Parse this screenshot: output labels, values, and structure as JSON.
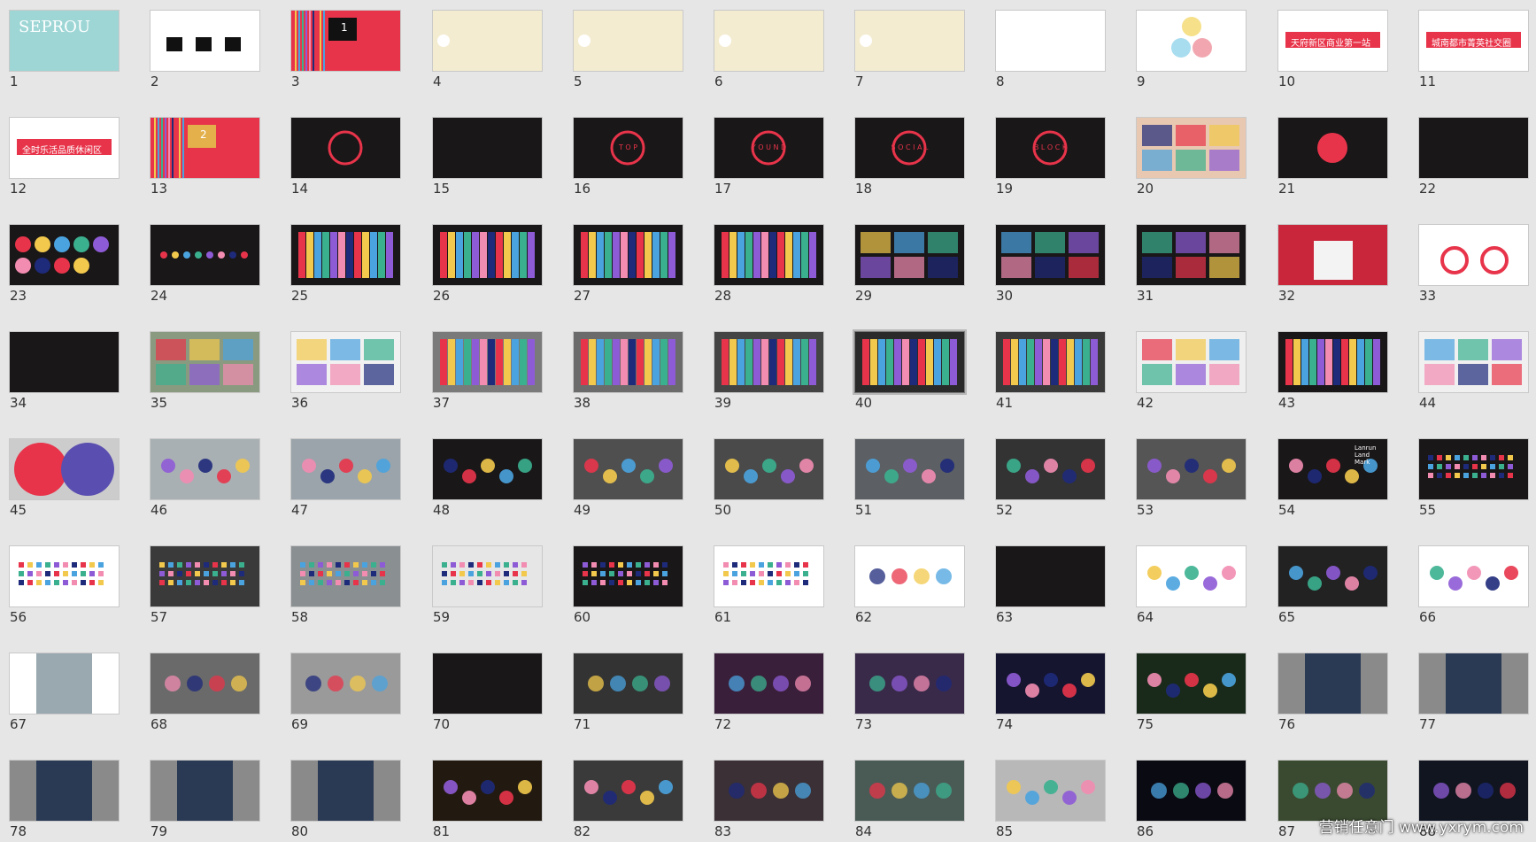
{
  "slides": [
    {
      "n": 1,
      "bg": "#9ed6d6",
      "title": "SEPROU"
    },
    {
      "n": 2,
      "bg": "#ffffff"
    },
    {
      "n": 3,
      "bg": "#e8344a",
      "title": "1"
    },
    {
      "n": 4,
      "bg": "#ffffff"
    },
    {
      "n": 5,
      "bg": "#ffffff"
    },
    {
      "n": 6,
      "bg": "#ffffff"
    },
    {
      "n": 7,
      "bg": "#ffffff"
    },
    {
      "n": 8,
      "bg": "#ffffff"
    },
    {
      "n": 9,
      "bg": "#ffffff"
    },
    {
      "n": 10,
      "bg": "#ffffff",
      "title": "天府新区商业第一站"
    },
    {
      "n": 11,
      "bg": "#ffffff",
      "title": "城南都市菁英社交圈"
    },
    {
      "n": 12,
      "bg": "#ffffff",
      "title": "全时乐活品质休闲区"
    },
    {
      "n": 13,
      "bg": "#e8344a",
      "title": "2"
    },
    {
      "n": 14,
      "bg": "#1a1718"
    },
    {
      "n": 15,
      "bg": "#1a1718"
    },
    {
      "n": 16,
      "bg": "#1a1718",
      "title": "T O P"
    },
    {
      "n": 17,
      "bg": "#1a1718",
      "title": "Y O U N D"
    },
    {
      "n": 18,
      "bg": "#1a1718",
      "title": "S O C I A L"
    },
    {
      "n": 19,
      "bg": "#1a1718",
      "title": "B L O C K"
    },
    {
      "n": 20,
      "bg": "#e8c8b0"
    },
    {
      "n": 21,
      "bg": "#1a1718"
    },
    {
      "n": 22,
      "bg": "#1a1718"
    },
    {
      "n": 23,
      "bg": "#1a1718"
    },
    {
      "n": 24,
      "bg": "#1a1718"
    },
    {
      "n": 25,
      "bg": "#1a1718"
    },
    {
      "n": 26,
      "bg": "#1a1718"
    },
    {
      "n": 27,
      "bg": "#1a1718"
    },
    {
      "n": 28,
      "bg": "#1a1718"
    },
    {
      "n": 29,
      "bg": "#1a1718"
    },
    {
      "n": 30,
      "bg": "#1a1718"
    },
    {
      "n": 31,
      "bg": "#1a1718"
    },
    {
      "n": 32,
      "bg": "#c9263c"
    },
    {
      "n": 33,
      "bg": "#ffffff"
    },
    {
      "n": 34,
      "bg": "#1a1718"
    },
    {
      "n": 35,
      "bg": "#8a9a80"
    },
    {
      "n": 36,
      "bg": "#f1f1f1"
    },
    {
      "n": 37,
      "bg": "#7a7a7a"
    },
    {
      "n": 38,
      "bg": "#6b6b6b"
    },
    {
      "n": 39,
      "bg": "#444444"
    },
    {
      "n": 40,
      "bg": "#2a2a2a"
    },
    {
      "n": 41,
      "bg": "#3a3a3a"
    },
    {
      "n": 42,
      "bg": "#efefef"
    },
    {
      "n": 43,
      "bg": "#1a1718"
    },
    {
      "n": 44,
      "bg": "#f0f0f0"
    },
    {
      "n": 45,
      "bg": "#cccccc"
    },
    {
      "n": 46,
      "bg": "#a9b0b3"
    },
    {
      "n": 47,
      "bg": "#9aa4aa"
    },
    {
      "n": 48,
      "bg": "#1a1718"
    },
    {
      "n": 49,
      "bg": "#4f4f4f"
    },
    {
      "n": 50,
      "bg": "#4a4a4a"
    },
    {
      "n": 51,
      "bg": "#5c5f63"
    },
    {
      "n": 52,
      "bg": "#333333"
    },
    {
      "n": 53,
      "bg": "#555555"
    },
    {
      "n": 54,
      "bg": "#1a1718",
      "title": "Lanrun Land Mark"
    },
    {
      "n": 55,
      "bg": "#1a1718"
    },
    {
      "n": 56,
      "bg": "#ffffff"
    },
    {
      "n": 57,
      "bg": "#3a3a3a"
    },
    {
      "n": 58,
      "bg": "#8a8f92"
    },
    {
      "n": 59,
      "bg": "#e6e6e6"
    },
    {
      "n": 60,
      "bg": "#1a1718"
    },
    {
      "n": 61,
      "bg": "#ffffff"
    },
    {
      "n": 62,
      "bg": "#ffffff"
    },
    {
      "n": 63,
      "bg": "#1a1718"
    },
    {
      "n": 64,
      "bg": "#ffffff"
    },
    {
      "n": 65,
      "bg": "#222222"
    },
    {
      "n": 66,
      "bg": "#ffffff"
    },
    {
      "n": 67,
      "bg": "#ffffff"
    },
    {
      "n": 68,
      "bg": "#6a6a6a"
    },
    {
      "n": 69,
      "bg": "#9a9a9a"
    },
    {
      "n": 70,
      "bg": "#1a1718"
    },
    {
      "n": 71,
      "bg": "#333333"
    },
    {
      "n": 72,
      "bg": "#3a1f3a"
    },
    {
      "n": 73,
      "bg": "#3a2a4a"
    },
    {
      "n": 74,
      "bg": "#151530"
    },
    {
      "n": 75,
      "bg": "#1a2a1a"
    },
    {
      "n": 76,
      "bg": "#8a8a8a"
    },
    {
      "n": 77,
      "bg": "#8a8a8a"
    },
    {
      "n": 78,
      "bg": "#8a8a8a"
    },
    {
      "n": 79,
      "bg": "#8a8a8a"
    },
    {
      "n": 80,
      "bg": "#8a8a8a"
    },
    {
      "n": 81,
      "bg": "#221a10"
    },
    {
      "n": 82,
      "bg": "#3a3a3a"
    },
    {
      "n": 83,
      "bg": "#3a3035"
    },
    {
      "n": 84,
      "bg": "#4a5a55"
    },
    {
      "n": 85,
      "bg": "#b8b8b8"
    },
    {
      "n": 86,
      "bg": "#0a0a12"
    },
    {
      "n": 87,
      "bg": "#3a4a30"
    },
    {
      "n": 88,
      "bg": "#101520"
    }
  ],
  "selected": 40,
  "watermark": "营销任意门 www.yxrym.com"
}
